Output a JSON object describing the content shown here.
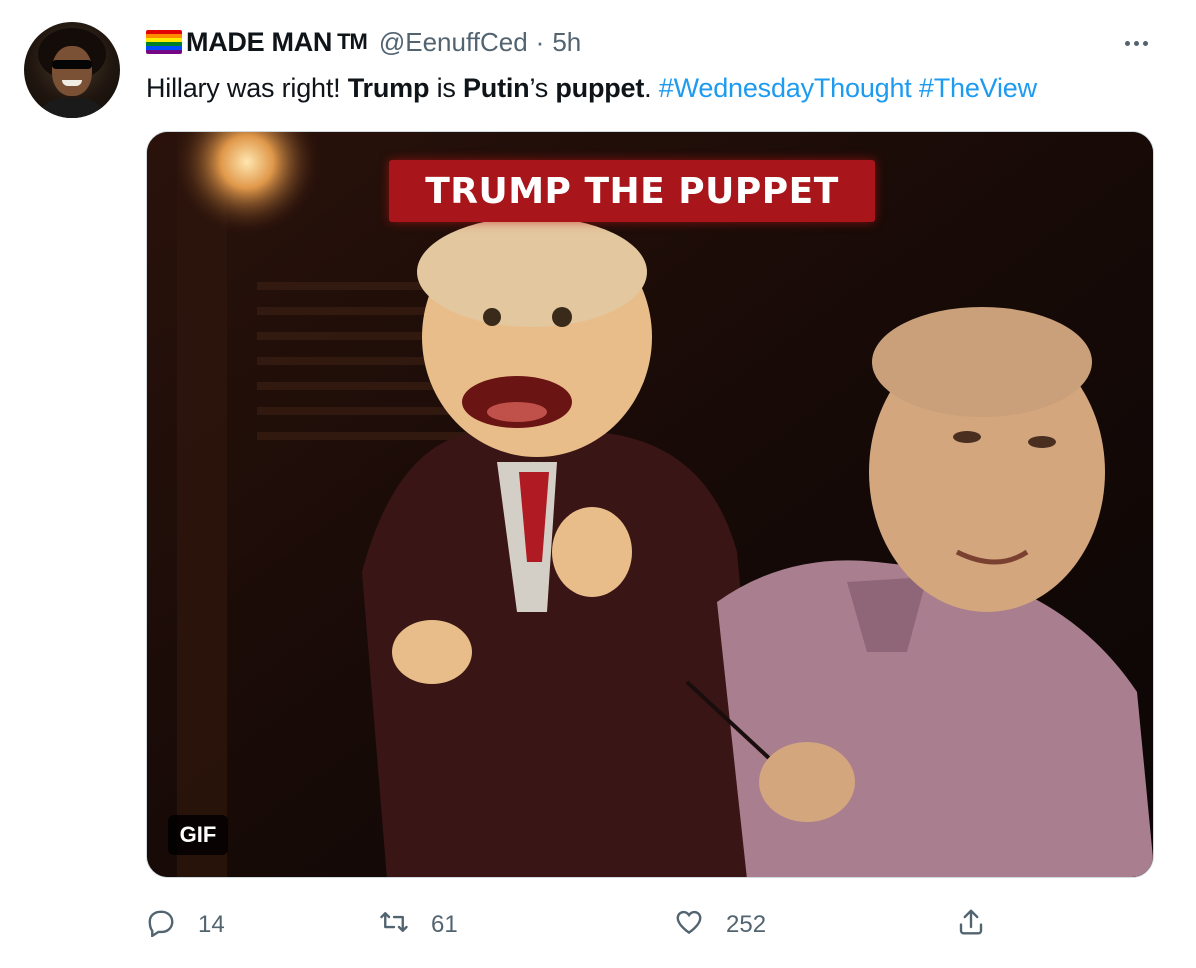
{
  "author": {
    "display_name": "MADE MAN",
    "tm_mark": "TM",
    "handle": "@EenuffCed",
    "separator": "·",
    "time_ago": "5h",
    "flag_colors": [
      "#e40303",
      "#ff8c00",
      "#ffed00",
      "#008026",
      "#004dff",
      "#750787"
    ]
  },
  "tweet": {
    "t1": "Hillary was right! ",
    "b1": "Trump",
    "t2": " is ",
    "b2": "Putin",
    "t3": "’s ",
    "b3": "puppet",
    "t4": ". ",
    "hashtag1": "#WednesdayThought",
    "hashtag2": "#TheView"
  },
  "media": {
    "title_overlay": "TRUMP THE PUPPET",
    "badge": "GIF"
  },
  "actions": {
    "reply_count": "14",
    "retweet_count": "61",
    "like_count": "252"
  },
  "colors": {
    "hashtag": "#1d9bf0",
    "secondary_text": "#536471"
  },
  "icons": [
    "more-icon",
    "reply-icon",
    "retweet-icon",
    "like-icon",
    "share-icon"
  ]
}
